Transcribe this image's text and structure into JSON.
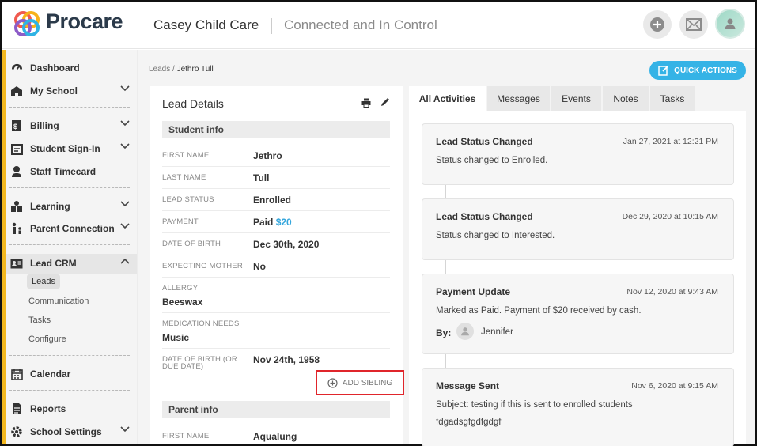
{
  "header": {
    "logo_text": "Procare",
    "school_name": "Casey Child Care",
    "tagline": "Connected and In Control"
  },
  "sidebar": {
    "items": [
      {
        "label": "Dashboard",
        "icon": "dashboard-icon"
      },
      {
        "label": "My School",
        "icon": "school-icon"
      },
      {
        "label": "Billing",
        "icon": "billing-icon"
      },
      {
        "label": "Student Sign-In",
        "icon": "sign-in-icon"
      },
      {
        "label": "Staff Timecard",
        "icon": "timecard-icon"
      },
      {
        "label": "Learning",
        "icon": "learning-icon"
      },
      {
        "label": "Parent Connection",
        "icon": "parent-icon"
      },
      {
        "label": "Lead CRM",
        "icon": "lead-crm-icon"
      },
      {
        "label": "Calendar",
        "icon": "calendar-icon"
      },
      {
        "label": "Reports",
        "icon": "reports-icon"
      },
      {
        "label": "School Settings",
        "icon": "settings-icon"
      }
    ],
    "sub_items": [
      "Leads",
      "Communication",
      "Tasks",
      "Configure"
    ]
  },
  "breadcrumb": {
    "parent": "Leads",
    "sep": "/",
    "current": "Jethro Tull"
  },
  "quick_actions_label": "QUICK ACTIONS",
  "lead_details": {
    "title": "Lead Details",
    "student_section": "Student info",
    "fields": {
      "first_name": {
        "label": "FIRST NAME",
        "value": "Jethro"
      },
      "last_name": {
        "label": "LAST NAME",
        "value": "Tull"
      },
      "lead_status": {
        "label": "LEAD STATUS",
        "value": "Enrolled"
      },
      "payment": {
        "label": "PAYMENT",
        "value": "Paid",
        "amount": "$20"
      },
      "dob": {
        "label": "DATE OF BIRTH",
        "value": "Dec 30th, 2020"
      },
      "expecting_mother": {
        "label": "EXPECTING MOTHER",
        "value": "No"
      },
      "allergy": {
        "label": "ALLERGY",
        "value": "Beeswax"
      },
      "medication": {
        "label": "MEDICATION NEEDS",
        "value": "Music"
      },
      "dob_due_line1": "DATE OF BIRTH (OR",
      "dob_due_line2": "DUE DATE)",
      "dob_due_value": "Nov 24th, 1958"
    },
    "add_sibling": "ADD SIBLING",
    "parent_section": "Parent info",
    "parent_first_name": {
      "label": "FIRST NAME",
      "value": "Aqualung"
    }
  },
  "tabs": [
    "All Activities",
    "Messages",
    "Events",
    "Notes",
    "Tasks"
  ],
  "activities": [
    {
      "title": "Lead Status Changed",
      "date": "Jan 27, 2021 at 12:21 PM",
      "desc": "Status changed to Enrolled."
    },
    {
      "title": "Lead Status Changed",
      "date": "Dec 29, 2020 at 10:15 AM",
      "desc": "Status changed to Interested."
    },
    {
      "title": "Payment Update",
      "date": "Nov 12, 2020 at 9:43 AM",
      "desc": "Marked as Paid. Payment of $20 received by cash.",
      "by_label": "By:",
      "by_name": "Jennifer"
    },
    {
      "title": "Message Sent",
      "date": "Nov 6, 2020 at 9:15 AM",
      "desc": "Subject: testing if this is sent to enrolled students",
      "desc2": "fdgadsgfgdfgdgf"
    }
  ],
  "colors": {
    "accent_blue": "#35b3e6",
    "sidebar_accent": "#f3b81f",
    "highlight_red": "#e0252b"
  }
}
